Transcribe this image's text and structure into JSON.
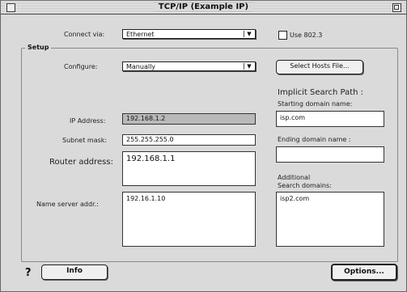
{
  "window": {
    "title": "TCP/IP (Example IP)"
  },
  "connect_via": {
    "label": "Connect via:",
    "value": "Ethernet"
  },
  "use_8023": {
    "label": "Use 802.3"
  },
  "setup": {
    "label": "Setup",
    "configure": {
      "label": "Configure:",
      "value": "Manually"
    },
    "select_hosts_button": "Select Hosts File...",
    "ip_address": {
      "label": "IP Address:",
      "value": "192.168.1.2"
    },
    "subnet_mask": {
      "label": "Subnet mask:",
      "value": "255.255.255.0"
    },
    "router_address": {
      "label": "Router address:",
      "value": "192.168.1.1"
    },
    "name_server": {
      "label": "Name server addr.:",
      "value": "192.16.1.10"
    },
    "implicit_search": {
      "heading": "Implicit Search Path :",
      "starting_label": "Starting domain name:",
      "starting_value": "isp.com",
      "ending_label": "Ending domain name :",
      "ending_value": ""
    },
    "additional": {
      "label_line1": "Additional",
      "label_line2": "Search domains:",
      "value": "isp2.com"
    }
  },
  "footer": {
    "help": "?",
    "info_button": "Info",
    "options_button": "Options..."
  }
}
